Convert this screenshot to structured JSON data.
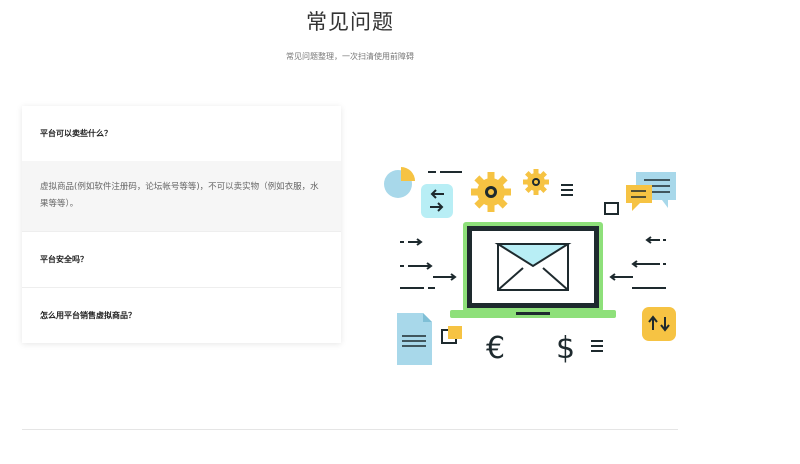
{
  "header": {
    "title": "常见问题",
    "subtitle": "常见问题整理，一次扫清使用前障碍"
  },
  "faq": {
    "items": [
      {
        "question": "平台可以卖些什么？",
        "answer": "虚拟商品(例如软件注册码，论坛帐号等等)，不可以卖实物（例如衣服，水果等等）。",
        "expanded": true
      },
      {
        "question": "平台安全吗？",
        "expanded": false
      },
      {
        "question": "怎么用平台销售虚拟商品？",
        "expanded": false
      }
    ]
  },
  "illustration": {
    "icons": [
      "pie-chart-icon",
      "gear-icon",
      "menu-lines-icon",
      "chat-bubble-icon",
      "arrows-swap-icon",
      "laptop-icon",
      "envelope-icon",
      "document-icon",
      "euro-icon",
      "dollar-icon",
      "up-down-arrows-icon"
    ],
    "symbols": {
      "euro": "€",
      "dollar": "$",
      "lines": "≡"
    },
    "colors": {
      "yellow": "#f6c343",
      "light_blue": "#a8d8ea",
      "cyan": "#b8eef5",
      "green": "#8ee07a",
      "dark": "#1e2a2e"
    }
  }
}
